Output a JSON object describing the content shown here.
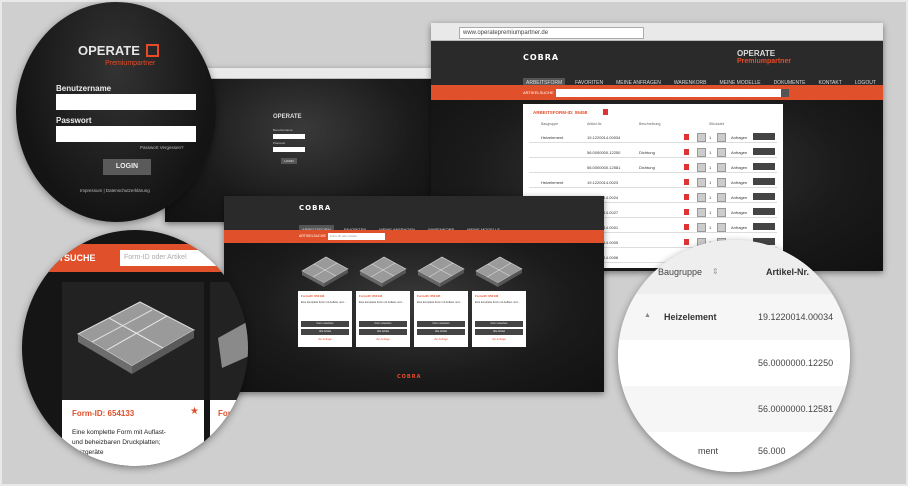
{
  "login_window": {
    "brand": "OPERATE",
    "brand_sub": "Premiumpartner",
    "username_label": "Benutzername",
    "password_label": "Passwort",
    "forgot": "Passwort Vergessen?",
    "login_button": "LOGIN",
    "footer_left": "Impressum",
    "footer_right": "Datenschutzerklärung"
  },
  "list_window": {
    "address": "www.operatepremiumpartner.de",
    "logo": "COBRA",
    "brand": "OPERATE",
    "brand_sub": "Premiumpartner",
    "nav": [
      "ARBEITSFORM",
      "FAVORITEN",
      "MEINE ANFRAGEN",
      "WARENKORB",
      "MEINE MODELLE",
      "DOKUMENTE",
      "KONTAKT",
      "LOGOUT"
    ],
    "search_label": "ARTIKELSUCHE",
    "section_title": "ARBEITSFORM-ID: 06458",
    "columns": [
      "Baugruppe",
      "Artikel-Nr.",
      "Beschreibung",
      "Stückzahl"
    ],
    "rows": [
      {
        "group": "Heizelement",
        "article": "19.1220014.00034",
        "desc": "",
        "qty": "1",
        "action": "Anfragen"
      },
      {
        "group": "",
        "article": "56.0000000.12250",
        "desc": "Dichtung",
        "qty": "1",
        "action": "Anfragen"
      },
      {
        "group": "",
        "article": "56.0000000.12581",
        "desc": "Dichtung",
        "qty": "1",
        "action": "Anfragen"
      },
      {
        "group": "Heizelement",
        "article": "19.1220014.0023",
        "desc": "",
        "qty": "1",
        "action": "Anfragen"
      },
      {
        "group": "Heizelement",
        "article": "19.1220014.0024",
        "desc": "",
        "qty": "1",
        "action": "Anfragen"
      },
      {
        "group": "Schneidplatte",
        "article": "19.1220014.0027",
        "desc": "",
        "qty": "1",
        "action": "Anfragen"
      },
      {
        "group": "Form 1",
        "article": "19.1220014.0001",
        "desc": "",
        "qty": "1",
        "action": "Anfragen"
      },
      {
        "group": "Auswerfplatte",
        "article": "19.1220014.0005",
        "desc": "",
        "qty": "1",
        "action": "Anfragen"
      },
      {
        "group": "Ausbaupl.",
        "article": "19.1220014.0006",
        "desc": "",
        "qty": "1",
        "action": "Anfragen"
      }
    ]
  },
  "forms_window": {
    "logo": "COBRA",
    "nav": [
      "ARBEITSFORM",
      "FAVORITEN",
      "MEINE ANFRAGEN",
      "WARENKORB",
      "MEINE MODELLE"
    ],
    "search_label": "ARTIKELSUCHE",
    "search_placeholder": "Form-ID oder Artikel",
    "cards": [
      {
        "id": "Form-ID: 654133",
        "text": "Eine komplette Form mit Auflast- und ...",
        "btn1": "Form ansehen",
        "btn2": "Alle Artikel",
        "link": "Zur Anfrage"
      },
      {
        "id": "Form-ID: 654134",
        "text": "Eine komplette Form mit Auflast- und ...",
        "btn1": "Form ansehen",
        "btn2": "Alle Artikel",
        "link": "Zur Anfrage"
      },
      {
        "id": "Form-ID: 654135",
        "text": "Eine komplette Form mit Auflast- und ...",
        "btn1": "Form ansehen",
        "btn2": "Alle Artikel",
        "link": "Zur Anfrage"
      },
      {
        "id": "Form-ID: 654136",
        "text": "Eine komplette Form mit Auflast- und ...",
        "btn1": "Form ansehen",
        "btn2": "Alle Artikel",
        "link": "Zur Anfrage"
      }
    ],
    "footer_logo": "COBRA"
  },
  "zoom_login": {
    "brand": "OPERATE",
    "brand_sub": "Premiumpartner",
    "username_label": "Benutzername",
    "password_label": "Passwort",
    "forgot": "Passwort Vergessen?",
    "login_button": "LOGIN",
    "footer": "Impressum | Datenschutzerklärung"
  },
  "zoom_card": {
    "search_label": "RTSUCHE",
    "search_placeholder": "Form-ID oder Artikel",
    "card_id": "Form-ID: 654133",
    "card_id2": "Form-ID",
    "text_lines": [
      "Eine komplette Form mit Auflast-",
      "und beheizbaren Druckplatten;",
      "Heizgeräte"
    ],
    "text_lines2": [
      "Eine",
      "und",
      "Heiz"
    ]
  },
  "zoom_table": {
    "col1": "Baugruppe",
    "col2": "Artikel-Nr.",
    "rows": [
      {
        "group": "Heizelement",
        "article": "19.1220014.00034"
      },
      {
        "group": "",
        "article": "56.0000000.12250"
      },
      {
        "group": "",
        "article": "56.0000000.12581"
      },
      {
        "group": "ment",
        "article": "56.000"
      }
    ]
  },
  "colors": {
    "accent": "#e0502a",
    "dark": "#1b1b1b",
    "nav": "#2a2a2a"
  }
}
